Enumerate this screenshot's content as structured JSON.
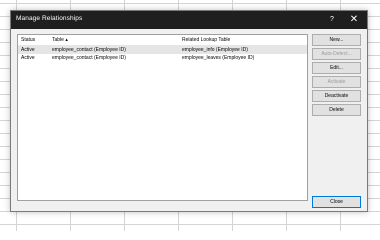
{
  "dialog": {
    "title": "Manage Relationships",
    "help": "?",
    "close_glyph": "✕"
  },
  "table": {
    "columns": [
      "Status",
      "Table ▴",
      "Related Lookup Table"
    ],
    "rows": [
      {
        "status": "Active",
        "table": "employee_contact (Employee ID)",
        "lookup": "employee_info (Employee ID)"
      },
      {
        "status": "Active",
        "table": "employee_contact (Employee ID)",
        "lookup": "employee_leaves (Employee ID)"
      }
    ]
  },
  "buttons": {
    "new": "New...",
    "auto_detect": "Auto-Detect...",
    "edit": "Edit...",
    "activate": "Activate",
    "deactivate": "Deactivate",
    "delete": "Delete",
    "close": "Close"
  }
}
